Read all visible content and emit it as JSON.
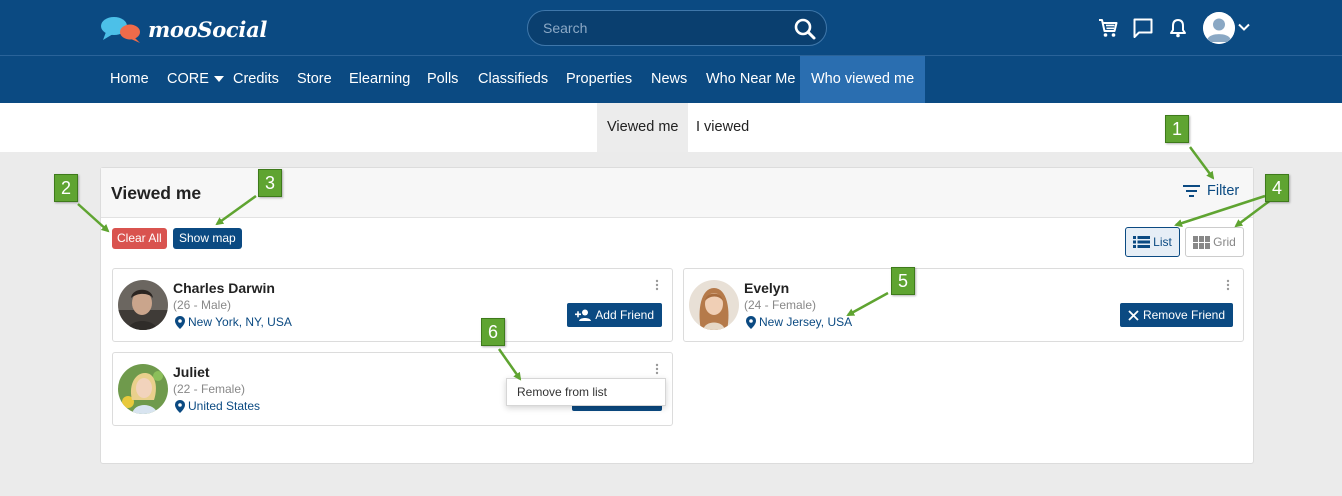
{
  "header": {
    "logo_text": "mooSocial",
    "search_placeholder": "Search",
    "icons": [
      "cart-icon",
      "messages-icon",
      "bell-icon",
      "user-avatar-icon",
      "chevron-down-icon"
    ]
  },
  "nav": {
    "items": [
      {
        "label": "Home"
      },
      {
        "label": "CORE"
      },
      {
        "label": "Credits"
      },
      {
        "label": "Store"
      },
      {
        "label": "Elearning"
      },
      {
        "label": "Polls"
      },
      {
        "label": "Classifieds"
      },
      {
        "label": "Properties"
      },
      {
        "label": "News"
      },
      {
        "label": "Who Near Me"
      },
      {
        "label": "Who viewed me"
      }
    ],
    "active": "Who viewed me"
  },
  "subtabs": [
    {
      "label": "Viewed me"
    },
    {
      "label": "I viewed"
    }
  ],
  "panel": {
    "title": "Viewed me",
    "filter_label": "Filter",
    "clear_label": "Clear All",
    "map_label": "Show map",
    "view_list_label": "List",
    "view_grid_label": "Grid"
  },
  "cards": [
    {
      "name": "Charles Darwin",
      "meta": "(26 - Male)",
      "location": "New York, NY, USA",
      "action": "Add Friend"
    },
    {
      "name": "Evelyn",
      "meta": "(24 - Female)",
      "location": "New Jersey, USA",
      "action": "Remove Friend"
    },
    {
      "name": "Juliet",
      "meta": "(22 - Female)",
      "location": "United States",
      "action": ""
    }
  ],
  "context_menu": {
    "item": "Remove from list"
  },
  "callouts": [
    "1",
    "2",
    "3",
    "4",
    "5",
    "6"
  ],
  "colors": {
    "brand": "#0b4a82",
    "nav_active": "#2a6eb0",
    "danger": "#d9534f",
    "callout": "#5fa431"
  }
}
